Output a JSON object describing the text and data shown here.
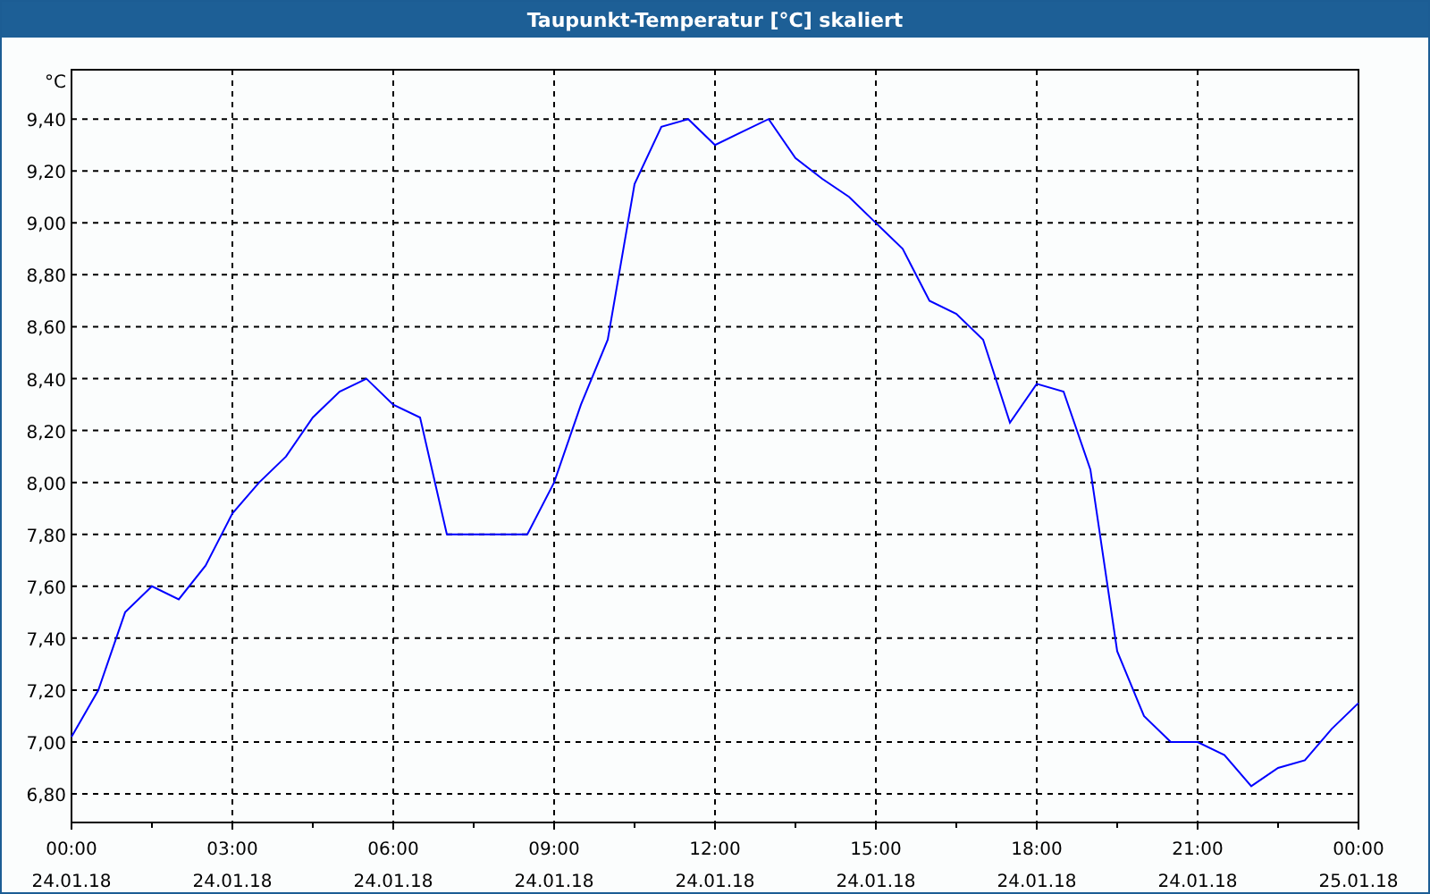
{
  "window": {
    "title": "Taupunkt-Temperatur [°C] skaliert"
  },
  "chart": {
    "chart_data": {
      "type": "line",
      "grid": true,
      "ylabel": "°C",
      "xlim": [
        0,
        24
      ],
      "ylim": [
        6.69,
        9.59
      ],
      "x": [
        0,
        0.5,
        1,
        1.5,
        2,
        2.5,
        3,
        3.5,
        4,
        4.5,
        5,
        5.5,
        6,
        6.5,
        7,
        7.5,
        8,
        8.5,
        9,
        9.5,
        10,
        10.5,
        11,
        11.5,
        12,
        12.5,
        13,
        13.5,
        14,
        14.5,
        15,
        15.5,
        16,
        16.5,
        17,
        17.5,
        18,
        18.5,
        19,
        19.5,
        20,
        20.5,
        21,
        21.5,
        22,
        22.5,
        23,
        23.5,
        24
      ],
      "series": [
        {
          "color": "#0000ff",
          "values": [
            7.02,
            7.2,
            7.5,
            7.6,
            7.55,
            7.68,
            7.88,
            8.0,
            8.1,
            8.25,
            8.35,
            8.4,
            8.3,
            8.25,
            7.8,
            7.8,
            7.8,
            7.8,
            8.0,
            8.3,
            8.55,
            9.15,
            9.37,
            9.4,
            9.3,
            9.35,
            9.4,
            9.25,
            9.17,
            9.1,
            9.0,
            8.9,
            8.7,
            8.65,
            8.55,
            8.23,
            8.38,
            8.35,
            8.05,
            7.35,
            7.1,
            7.0,
            7.0,
            6.95,
            6.83,
            6.9,
            6.93,
            7.05,
            7.15
          ]
        }
      ],
      "xticks": [
        {
          "value": 0,
          "label": "00:00"
        },
        {
          "value": 3,
          "label": "03:00"
        },
        {
          "value": 6,
          "label": "06:00"
        },
        {
          "value": 9,
          "label": "09:00"
        },
        {
          "value": 12,
          "label": "12:00"
        },
        {
          "value": 15,
          "label": "15:00"
        },
        {
          "value": 18,
          "label": "18:00"
        },
        {
          "value": 21,
          "label": "21:00"
        },
        {
          "value": 24,
          "label": "00:00"
        }
      ],
      "yticks": [
        {
          "value": 6.8,
          "label": "6,80"
        },
        {
          "value": 7.0,
          "label": "7,00"
        },
        {
          "value": 7.2,
          "label": "7,20"
        },
        {
          "value": 7.4,
          "label": "7,40"
        },
        {
          "value": 7.6,
          "label": "7,60"
        },
        {
          "value": 7.8,
          "label": "7,80"
        },
        {
          "value": 8.0,
          "label": "8,00"
        },
        {
          "value": 8.2,
          "label": "8,20"
        },
        {
          "value": 8.4,
          "label": "8,40"
        },
        {
          "value": 8.6,
          "label": "8,60"
        },
        {
          "value": 8.8,
          "label": "8,80"
        },
        {
          "value": 9.0,
          "label": "9,00"
        },
        {
          "value": 9.2,
          "label": "9,20"
        },
        {
          "value": 9.4,
          "label": "9,40"
        }
      ]
    },
    "date_labels": [
      "24.01.18",
      "24.01.18",
      "24.01.18",
      "24.01.18",
      "24.01.18",
      "24.01.18",
      "24.01.18",
      "24.01.18",
      "25.01.18"
    ]
  }
}
